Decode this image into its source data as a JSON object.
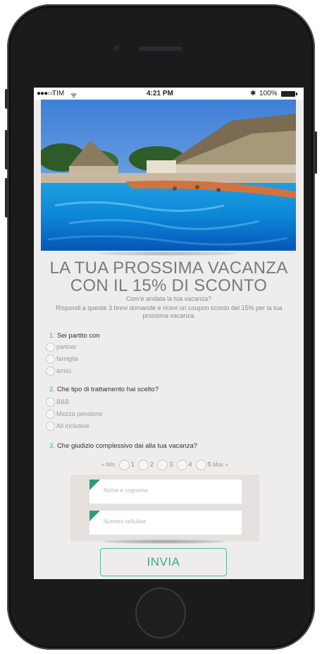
{
  "status_bar": {
    "signal": "●●●○○",
    "carrier": "TIM",
    "wifi": "ᯤ",
    "time": "4:21 PM",
    "bluetooth": "✱",
    "battery": "100%"
  },
  "hero": {
    "title_line1": "LA TUA PROSSIMA VACANZA",
    "title_line2": "CON IL 15% DI SCONTO",
    "subtitle": "Com'è andata la tua vacanza?",
    "description": "Rispondi a queste 3 brevi domande e ricevi un coupon sconto del 15% per la tua prossima vacanza."
  },
  "questions": [
    {
      "num": "1.",
      "text": "Sei partito con",
      "options": [
        "partner",
        "famiglia",
        "amici"
      ]
    },
    {
      "num": "2.",
      "text": "Che tipo di trattamento hai scelto?",
      "options": [
        "B&B",
        "Mezza pensione",
        "All inclusive"
      ]
    },
    {
      "num": "3.",
      "text": "Che giudizio complessivo dai alla tua vacanza?"
    }
  ],
  "rating": {
    "min_label": "« Min",
    "max_label": "Max »",
    "values": [
      "1",
      "2",
      "3",
      "4",
      "5"
    ]
  },
  "form": {
    "name_placeholder": "Nome e cognome",
    "phone_placeholder": "Numero cellulare"
  },
  "submit_label": "INVIA",
  "colors": {
    "accent": "#34b08d",
    "screen_bg": "#efedeb",
    "phone_body": "#1b1b1d"
  }
}
